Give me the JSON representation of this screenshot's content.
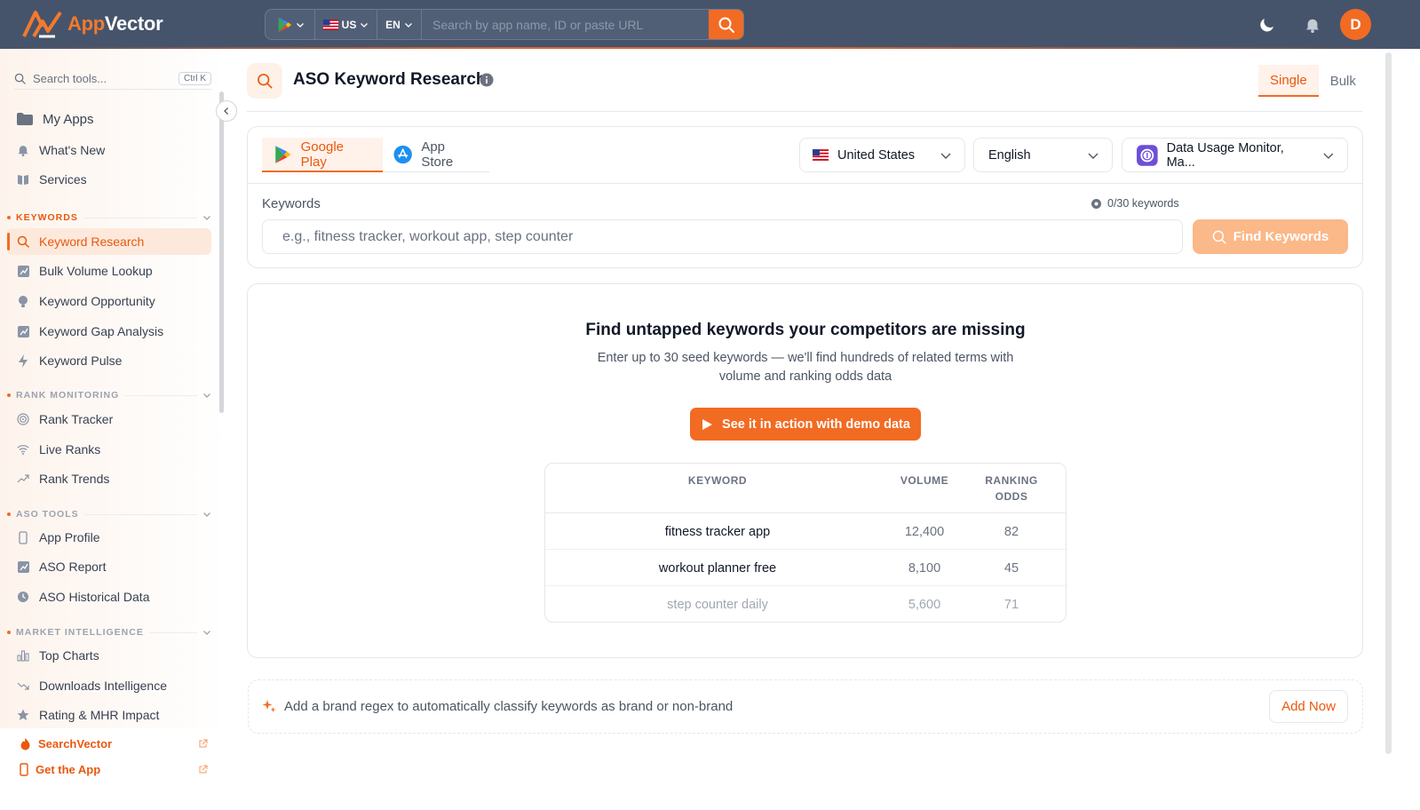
{
  "brand": {
    "name_part1": "App",
    "name_part2": "Vector"
  },
  "topbar": {
    "country": "US",
    "language": "EN",
    "search_placeholder": "Search by app name, ID or paste URL",
    "avatar_letter": "D"
  },
  "sidebar": {
    "search_placeholder": "Search tools...",
    "shortcut": "Ctrl K",
    "top_items": [
      {
        "label": "My Apps",
        "icon": "folder-icon"
      },
      {
        "label": "What's New",
        "icon": "bell-icon"
      },
      {
        "label": "Services",
        "icon": "book-icon"
      }
    ],
    "sections": [
      {
        "title": "KEYWORDS",
        "items": [
          "Keyword Research",
          "Bulk Volume Lookup",
          "Keyword Opportunity",
          "Keyword Gap Analysis",
          "Keyword Pulse"
        ]
      },
      {
        "title": "RANK MONITORING",
        "items": [
          "Rank Tracker",
          "Live Ranks",
          "Rank Trends"
        ]
      },
      {
        "title": "ASO TOOLS",
        "items": [
          "App Profile",
          "ASO Report",
          "ASO Historical Data"
        ]
      },
      {
        "title": "MARKET INTELLIGENCE",
        "items": [
          "Top Charts",
          "Downloads Intelligence",
          "Rating & MHR Impact"
        ]
      }
    ],
    "active_item": "Keyword Research",
    "external_links": [
      "SearchVector",
      "Get the App"
    ]
  },
  "page": {
    "title": "ASO Keyword Research",
    "mode_tabs": [
      "Single",
      "Bulk"
    ],
    "active_mode": "Single"
  },
  "form": {
    "store_tabs": [
      "Google Play",
      "App Store"
    ],
    "active_store": "Google Play",
    "country": "United States",
    "language": "English",
    "app": "Data Usage Monitor, Ma...",
    "keywords_label": "Keywords",
    "keyword_count": "0/30 keywords",
    "keywords_placeholder": "e.g., fitness tracker, workout app, step counter",
    "find_button": "Find Keywords"
  },
  "empty_state": {
    "title": "Find untapped keywords your competitors are missing",
    "subtitle": "Enter up to 30 seed keywords — we'll find hundreds of related terms with volume and ranking odds data",
    "demo_button": "See it in action with demo data",
    "table": {
      "headers": [
        "KEYWORD",
        "VOLUME",
        "RANKING ODDS"
      ],
      "rows": [
        [
          "fitness tracker app",
          "12,400",
          "82"
        ],
        [
          "workout planner free",
          "8,100",
          "45"
        ],
        [
          "step counter daily",
          "5,600",
          "71"
        ]
      ]
    }
  },
  "brand_regex": {
    "text": "Add a brand regex to automatically classify keywords as brand or non-brand",
    "button": "Add Now"
  },
  "colors": {
    "accent": "#f26b23",
    "topbar": "#46546b"
  }
}
